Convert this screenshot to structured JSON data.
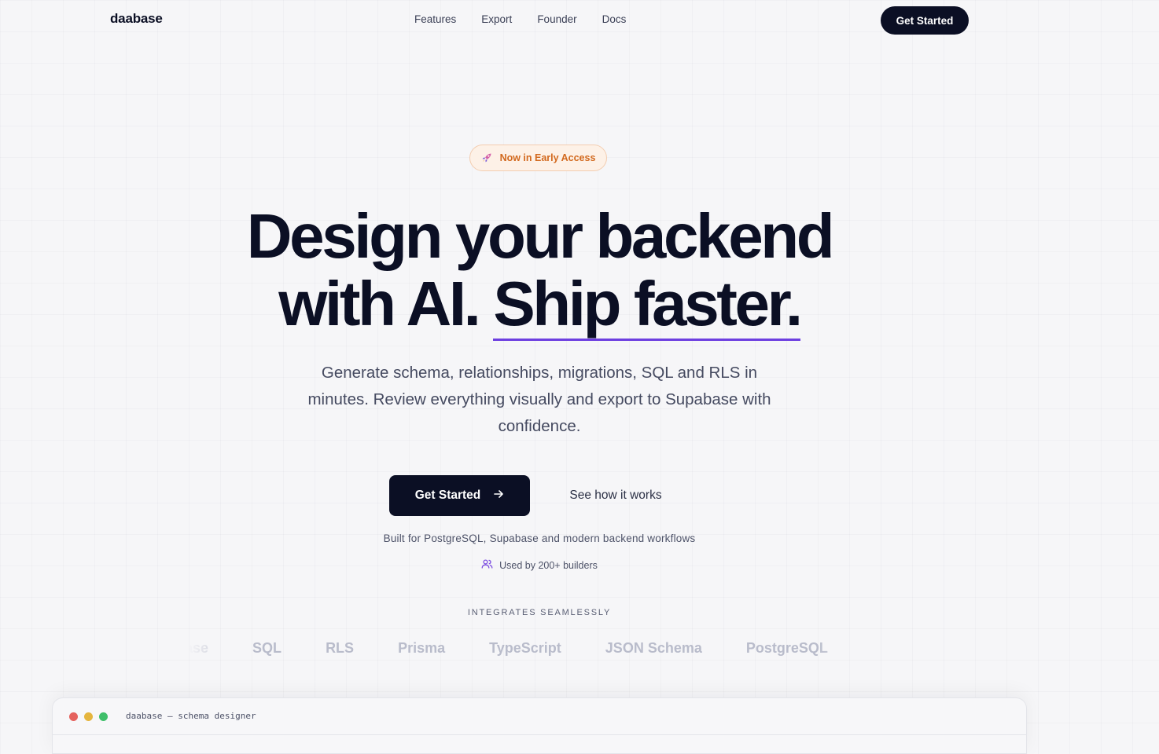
{
  "nav": {
    "brand": "daabase",
    "links": [
      "Features",
      "Export",
      "Founder",
      "Docs"
    ],
    "cta_label": "Get Started"
  },
  "hero": {
    "badge": {
      "icon": "rocket-icon",
      "label": "Now in Early Access"
    },
    "headline_part1": "Design your backend",
    "headline_part2": "with AI.",
    "headline_highlight": "Ship faster.",
    "subtitle": "Generate schema, relationships, migrations, SQL and RLS in minutes. Review everything visually and export to Supabase with confidence.",
    "primary_cta": "Get Started",
    "secondary_cta": "See how it works",
    "built_for": "Built for PostgreSQL, Supabase and modern backend workflows",
    "used_by": "Used by 200+ builders"
  },
  "integrations": {
    "heading": "INTEGRATES SEAMLESSLY",
    "logos": [
      "Supabase",
      "SQL",
      "RLS",
      "Prisma",
      "TypeScript",
      "JSON Schema",
      "PostgreSQL"
    ]
  },
  "preview_window": {
    "title": "daabase — schema designer",
    "dot_colors": [
      "#e5625e",
      "#e5b53e",
      "#3fbf6a"
    ]
  },
  "colors": {
    "accent": "#6d3fe0",
    "primary": "#0b0f24",
    "badge_text": "#d2691e"
  }
}
